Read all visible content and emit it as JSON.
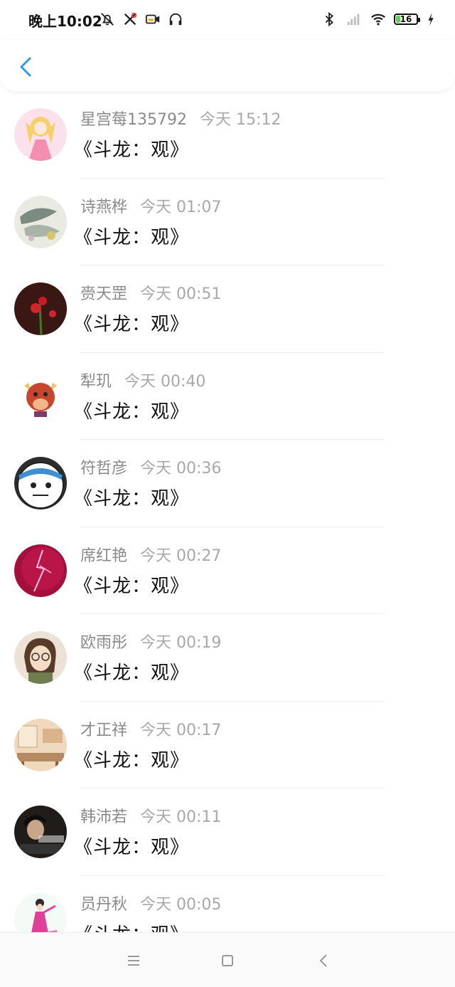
{
  "status_bar": {
    "time": "晚上10:02",
    "battery": "16",
    "icons": [
      "bell-off-icon",
      "tools-icon",
      "video-icon",
      "headphones-icon",
      "bluetooth-icon",
      "signal-icon",
      "wifi-icon",
      "battery-icon",
      "charging-icon"
    ]
  },
  "header": {
    "back_icon": "chevron-left-icon",
    "accent": "#2d9be8"
  },
  "messages": [
    {
      "name": "星宫莓135792",
      "time": "今天 15:12",
      "message": "《斗龙：观》",
      "avatar": "anime-girl-avatar"
    },
    {
      "name": "诗燕桦",
      "time": "今天 01:07",
      "message": "《斗龙：观》",
      "avatar": "sketch-avatar"
    },
    {
      "name": "赍天罡",
      "time": "今天 00:51",
      "message": "《斗龙：观》",
      "avatar": "red-flower-avatar"
    },
    {
      "name": "犁玑",
      "time": "今天 00:40",
      "message": "《斗龙：观》",
      "avatar": "bull-avatar"
    },
    {
      "name": "符哲彦",
      "time": "今天 00:36",
      "message": "《斗龙：观》",
      "avatar": "panda-avatar"
    },
    {
      "name": "席红艳",
      "time": "今天 00:27",
      "message": "《斗龙：观》",
      "avatar": "lightning-avatar"
    },
    {
      "name": "欧雨彤",
      "time": "今天 00:19",
      "message": "《斗龙：观》",
      "avatar": "glasses-girl-avatar"
    },
    {
      "name": "才正祥",
      "time": "今天 00:17",
      "message": "《斗龙：观》",
      "avatar": "room-avatar"
    },
    {
      "name": "韩沛若",
      "time": "今天 00:11",
      "message": "《斗龙：观》",
      "avatar": "dark-photo-avatar"
    },
    {
      "name": "员丹秋",
      "time": "今天 00:05",
      "message": "《斗龙：观》",
      "avatar": "dancer-avatar"
    }
  ],
  "nav_bar": {
    "items": [
      "menu-icon",
      "home-square-icon",
      "back-triangle-icon"
    ]
  }
}
